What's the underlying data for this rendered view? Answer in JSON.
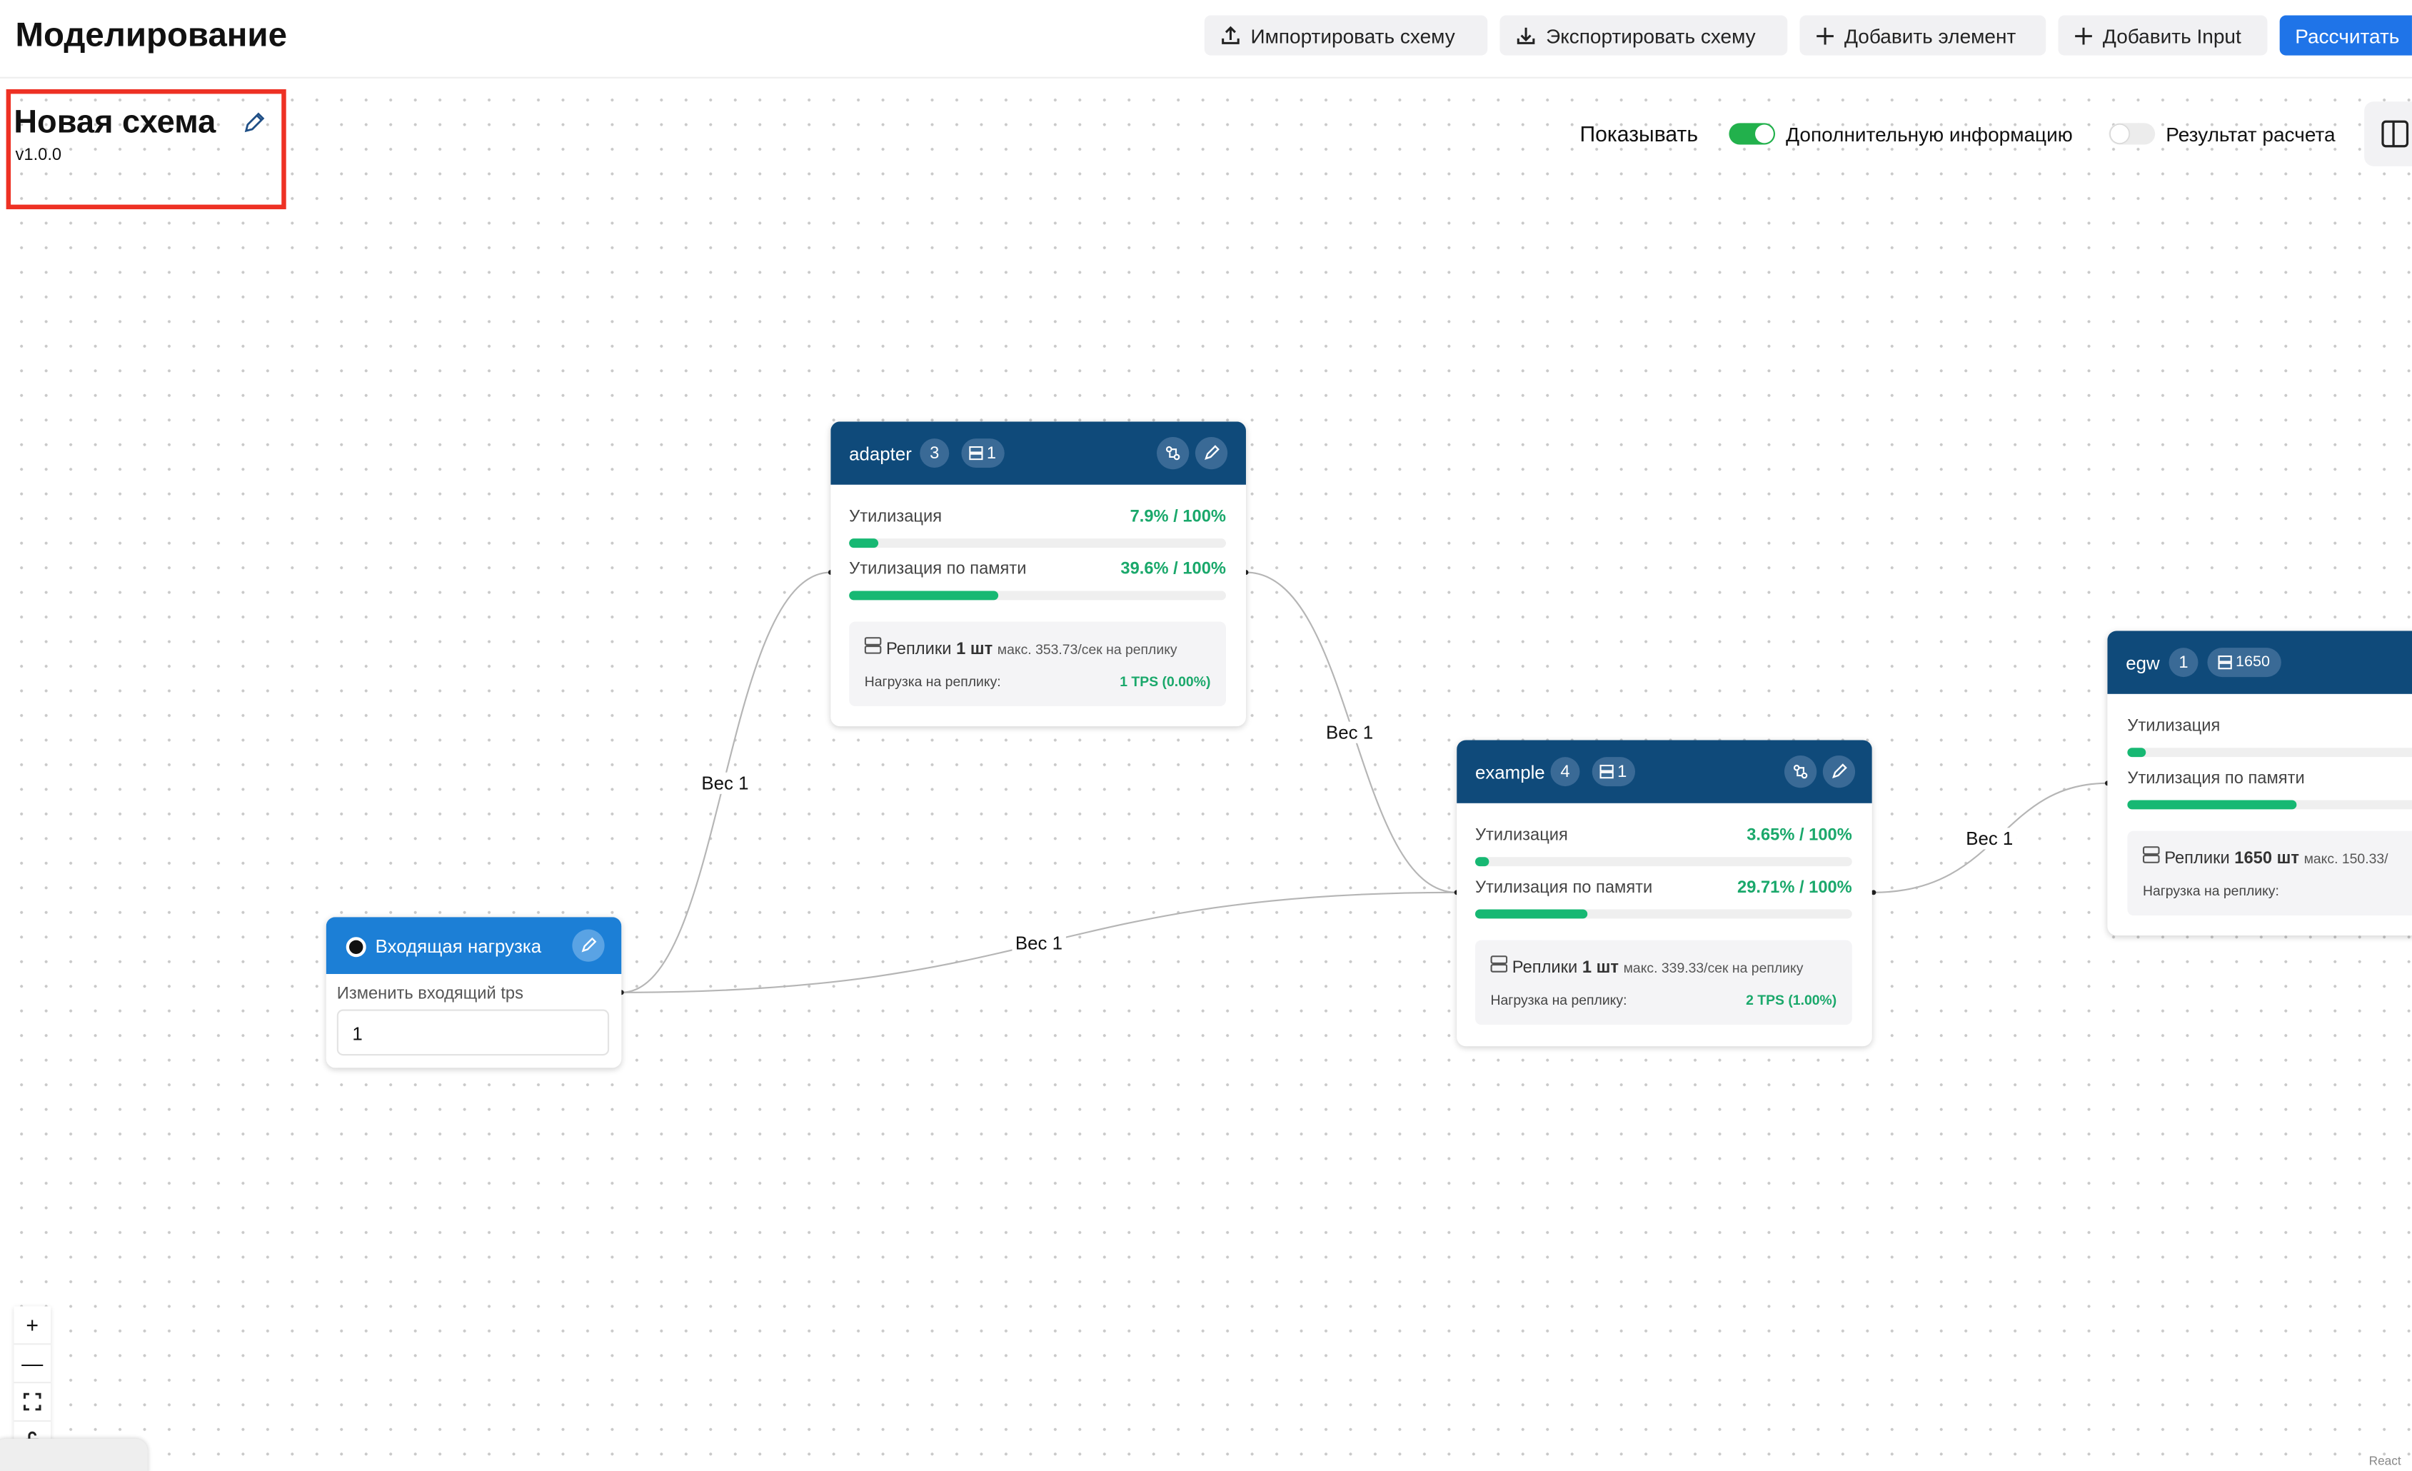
{
  "header": {
    "title": "Моделирование",
    "import_label": "Импортировать схему",
    "export_label": "Экспортировать схему",
    "add_element_label": "Добавить элемент",
    "add_input_label": "Добавить Input",
    "calculate_label": "Рассчитать"
  },
  "schema": {
    "name": "Новая схема",
    "version": "v1.0.0"
  },
  "view": {
    "show_label": "Показывать",
    "extra_info_label": "Дополнительную информацию",
    "extra_info_on": true,
    "result_label": "Результат расчета",
    "result_on": false
  },
  "input_node": {
    "title": "Входящая нагрузка",
    "change_label": "Изменить входящий tps",
    "value": "1"
  },
  "nodes": [
    {
      "name": "adapter",
      "count": "3",
      "replicas_badge": "1",
      "util_label": "Утилизация",
      "util_value": "7.9% / 100%",
      "util_fraction": 0.079,
      "mem_label": "Утилизация по памяти",
      "mem_value": "39.6% / 100%",
      "mem_fraction": 0.396,
      "replicas_label": "Реплики",
      "replicas_count": "1 шт",
      "replicas_max": "макс. 353.73/сек на реплику",
      "load_label": "Нагрузка на реплику:",
      "load_value": "1 TPS  (0.00%)"
    },
    {
      "name": "example",
      "count": "4",
      "replicas_badge": "1",
      "util_label": "Утилизация",
      "util_value": "3.65% / 100%",
      "util_fraction": 0.0365,
      "mem_label": "Утилизация по памяти",
      "mem_value": "29.71% / 100%",
      "mem_fraction": 0.2971,
      "replicas_label": "Реплики",
      "replicas_count": "1 шт",
      "replicas_max": "макс. 339.33/сек на реплику",
      "load_label": "Нагрузка на реплику:",
      "load_value": "2 TPS  (1.00%)"
    },
    {
      "name": "egw",
      "count": "1",
      "replicas_badge": "1650",
      "util_label": "Утилизация",
      "util_fraction": 0.05,
      "mem_label": "Утилизация по памяти",
      "mem_fraction": 0.45,
      "replicas_label": "Реплики",
      "replicas_count": "1650 шт",
      "replicas_max": "макс. 150.33/",
      "load_label": "Нагрузка на реплику:"
    }
  ],
  "edges": [
    {
      "label": "Вес 1"
    },
    {
      "label": "Вес 1"
    },
    {
      "label": "Вес 1"
    },
    {
      "label": "Вес 1"
    }
  ],
  "zoom_controls": {
    "zoom_in": "+",
    "zoom_out": "—"
  },
  "attribution": "React"
}
